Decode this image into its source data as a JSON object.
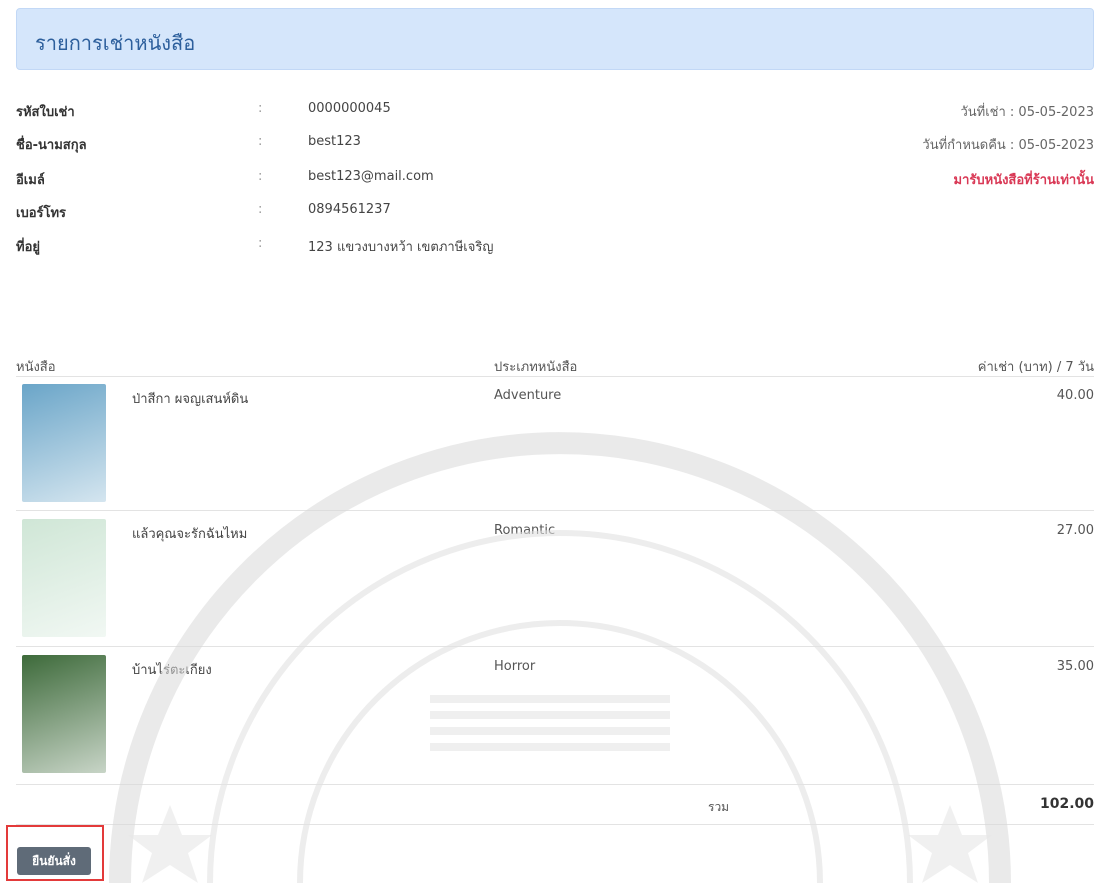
{
  "header": {
    "title": "รายการเช่าหนังสือ"
  },
  "info": [
    {
      "label": "รหัสใบเช่า",
      "value": "0000000045"
    },
    {
      "label": "ชื่อ-นามสกุล",
      "value": "best123"
    },
    {
      "label": "อีเมล์",
      "value": "best123@mail.com"
    },
    {
      "label": "เบอร์โทร",
      "value": "0894561237"
    },
    {
      "label": "ที่อยู่",
      "value": "123 แขวงบางหว้า เขตภาษีเจริญ"
    }
  ],
  "colon": ":",
  "meta": {
    "rent_date": "วันที่เช่า : 05-05-2023",
    "return_date": "วันที่กำหนดคืน : 05-05-2023",
    "pickup_note": "มารับหนังสือที่ร้านเท่านั้น"
  },
  "table": {
    "headers": {
      "book": "หนังสือ",
      "type": "ประเภทหนังสือ",
      "price": "ค่าเช่า (บาท) / 7 วัน"
    },
    "rows": [
      {
        "title": "ป่าสีกา ผจญเสนห์ดิน",
        "type": "Adventure",
        "price": "40.00",
        "cover": "#6aa5c8"
      },
      {
        "title": "แล้วคุณจะรักฉันไหม",
        "type": "Romantic",
        "price": "27.00",
        "cover": "#cfe6d6"
      },
      {
        "title": "บ้านไร่ตะเกียง",
        "type": "Horror",
        "price": "35.00",
        "cover": "#3d6a3a"
      }
    ],
    "total_label": "รวม",
    "total_value": "102.00"
  },
  "actions": {
    "confirm_label": "ยืนยันสั่ง"
  }
}
